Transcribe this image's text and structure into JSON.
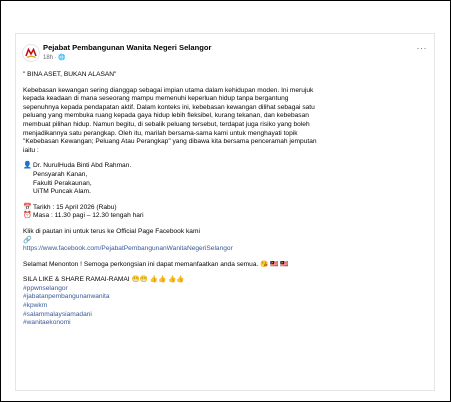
{
  "post": {
    "author": "Pejabat Pembangunan Wanita Negeri Selangor",
    "time": "18h",
    "privacy_icon": "globe-icon",
    "headline": "\" BINA ASET, BUKAN ALASAN\"",
    "body_lines": [
      "Kebebasan kewangan sering dianggap sebagai impian utama dalam kehidupan moden. Ini merujuk",
      "kepada keadaan di mana seseorang mampu memenuhi keperluan hidup tanpa bergantung",
      "sepenuhnya kepada pendapatan aktif. Dalam konteks ini, kebebasan kewangan dilihat sebagai satu",
      "peluang yang membuka ruang kepada gaya hidup lebih fleksibel, kurang tekanan, dan kebebasan",
      "membuat pilihan hidup. Namun begitu, di sebalik peluang tersebut, terdapat juga risiko yang boleh",
      "menjadikannya satu perangkap. Oleh itu, marilah bersama-sama kami untuk menghayati topik",
      "\"Kebebasan Kewangan; Peluang Atau Perangkap\" yang dibawa kita bersama penceramah jemputan",
      "iaitu :"
    ],
    "speaker_lines": [
      "Dr. NurulHuda Binti Abd Rahman.",
      "Pensyarah Kanan,",
      "Fakulti Perakaunan,",
      "UiTM Puncak Alam."
    ],
    "date": "Tarikh : 15 April 2026 (Rabu)",
    "time_slot": "Masa  : 11.30 pagi – 12.30 tengah hari",
    "link_intro": "Klik di pautan ini untuk terus ke Official Page Facebook kami",
    "link_url": "https://www.facebook.com/PejabatPembangunanWanitaNegeriSelangor",
    "closing": "Selamat Menonton ! Semoga perkongsian ini dapat memanfaatkan anda semua.",
    "closing_emoji": "😘 🇲🇾 🇲🇾",
    "share": "SILA LIKE & SHARE RAMAI-RAMAI",
    "share_emoji": "😁😁 👍👍 👍👍",
    "hashtags": [
      "#ppwnselangor",
      "#jabatanpembangunanwanita",
      "#kpwkm",
      "#salammalaysiamadani",
      "#wanitaekonomi"
    ]
  }
}
